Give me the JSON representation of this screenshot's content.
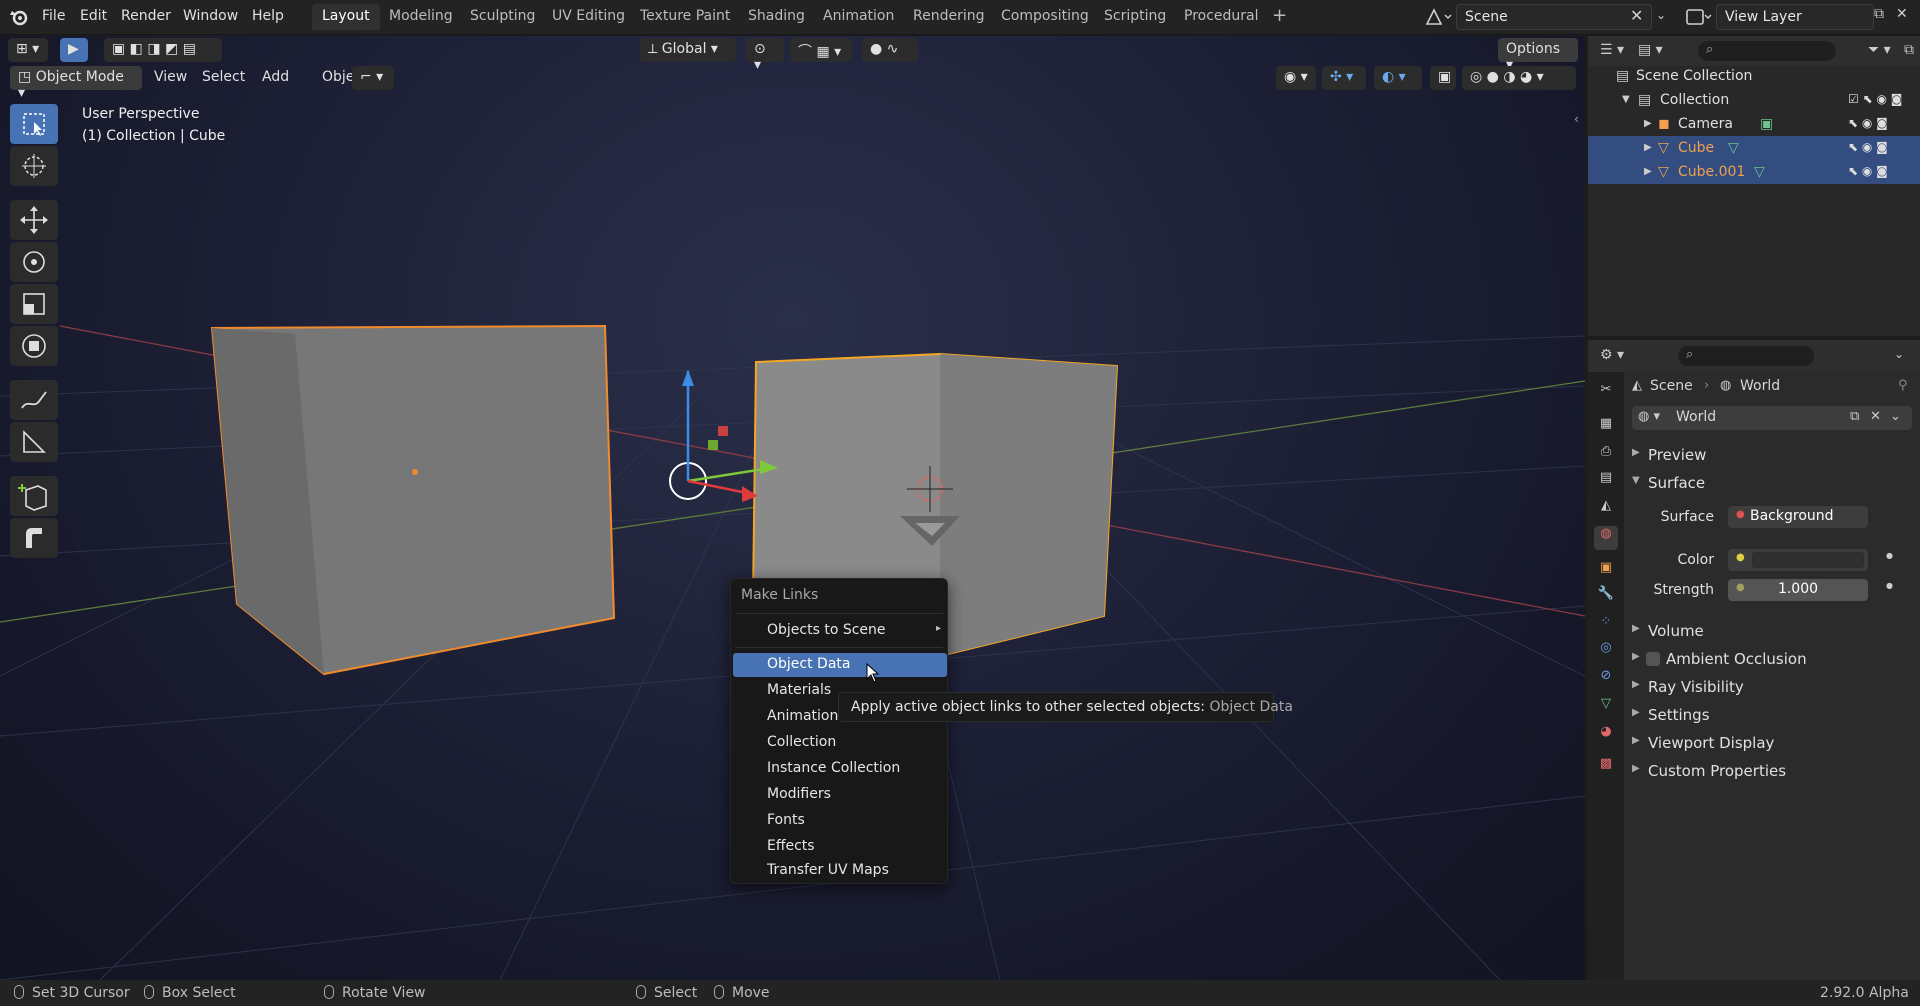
{
  "topbar": {
    "menus": [
      "File",
      "Edit",
      "Render",
      "Window",
      "Help"
    ],
    "workspaces": [
      "Layout",
      "Modeling",
      "Sculpting",
      "UV Editing",
      "Texture Paint",
      "Shading",
      "Animation",
      "Rendering",
      "Compositing",
      "Scripting",
      "Procedural"
    ],
    "active_workspace": "Layout",
    "scene": "Scene",
    "view_layer": "View Layer"
  },
  "viewport": {
    "orientation": "Global",
    "options_label": "Options",
    "mode": "Object Mode",
    "header_menus": [
      "View",
      "Select",
      "Add",
      "Object"
    ],
    "perspective_label": "User Perspective",
    "context_label": "(1) Collection | Cube"
  },
  "context_menu": {
    "title": "Make Links",
    "items": [
      {
        "label": "Objects to Scene",
        "submenu": true
      },
      {
        "label": "Object Data",
        "active": true
      },
      {
        "label": "Materials"
      },
      {
        "label": "Animation Data"
      },
      {
        "label": "Collection"
      },
      {
        "label": "Instance Collection"
      },
      {
        "label": "Modifiers"
      },
      {
        "label": "Fonts"
      },
      {
        "label": "Effects"
      },
      {
        "label": "Transfer UV Maps"
      }
    ],
    "tooltip_text": "Apply active object links to other selected objects:",
    "tooltip_value": "Object Data"
  },
  "outliner": {
    "scene_collection": "Scene Collection",
    "collection": "Collection",
    "objects": [
      {
        "name": "Camera",
        "selected": false
      },
      {
        "name": "Cube",
        "selected": true
      },
      {
        "name": "Cube.001",
        "selected": true
      }
    ]
  },
  "properties": {
    "breadcrumb_scene": "Scene",
    "breadcrumb_world": "World",
    "world_name": "World",
    "panels_top": [
      "Preview",
      "Surface"
    ],
    "surface_label": "Surface",
    "surface_value": "Background",
    "color_label": "Color",
    "strength_label": "Strength",
    "strength_value": "1.000",
    "panels_bottom": [
      "Volume",
      "Ambient Occlusion",
      "Ray Visibility",
      "Settings",
      "Viewport Display",
      "Custom Properties"
    ]
  },
  "statusbar": {
    "items": [
      "Set 3D Cursor",
      "Box Select",
      "Rotate View",
      "Select",
      "Move"
    ],
    "version": "2.92.0 Alpha"
  },
  "colors": {
    "accent": "#4772b3",
    "selection_row": "#334d80",
    "object_outline": "#f08a2c",
    "active_outline": "#f5a623"
  }
}
